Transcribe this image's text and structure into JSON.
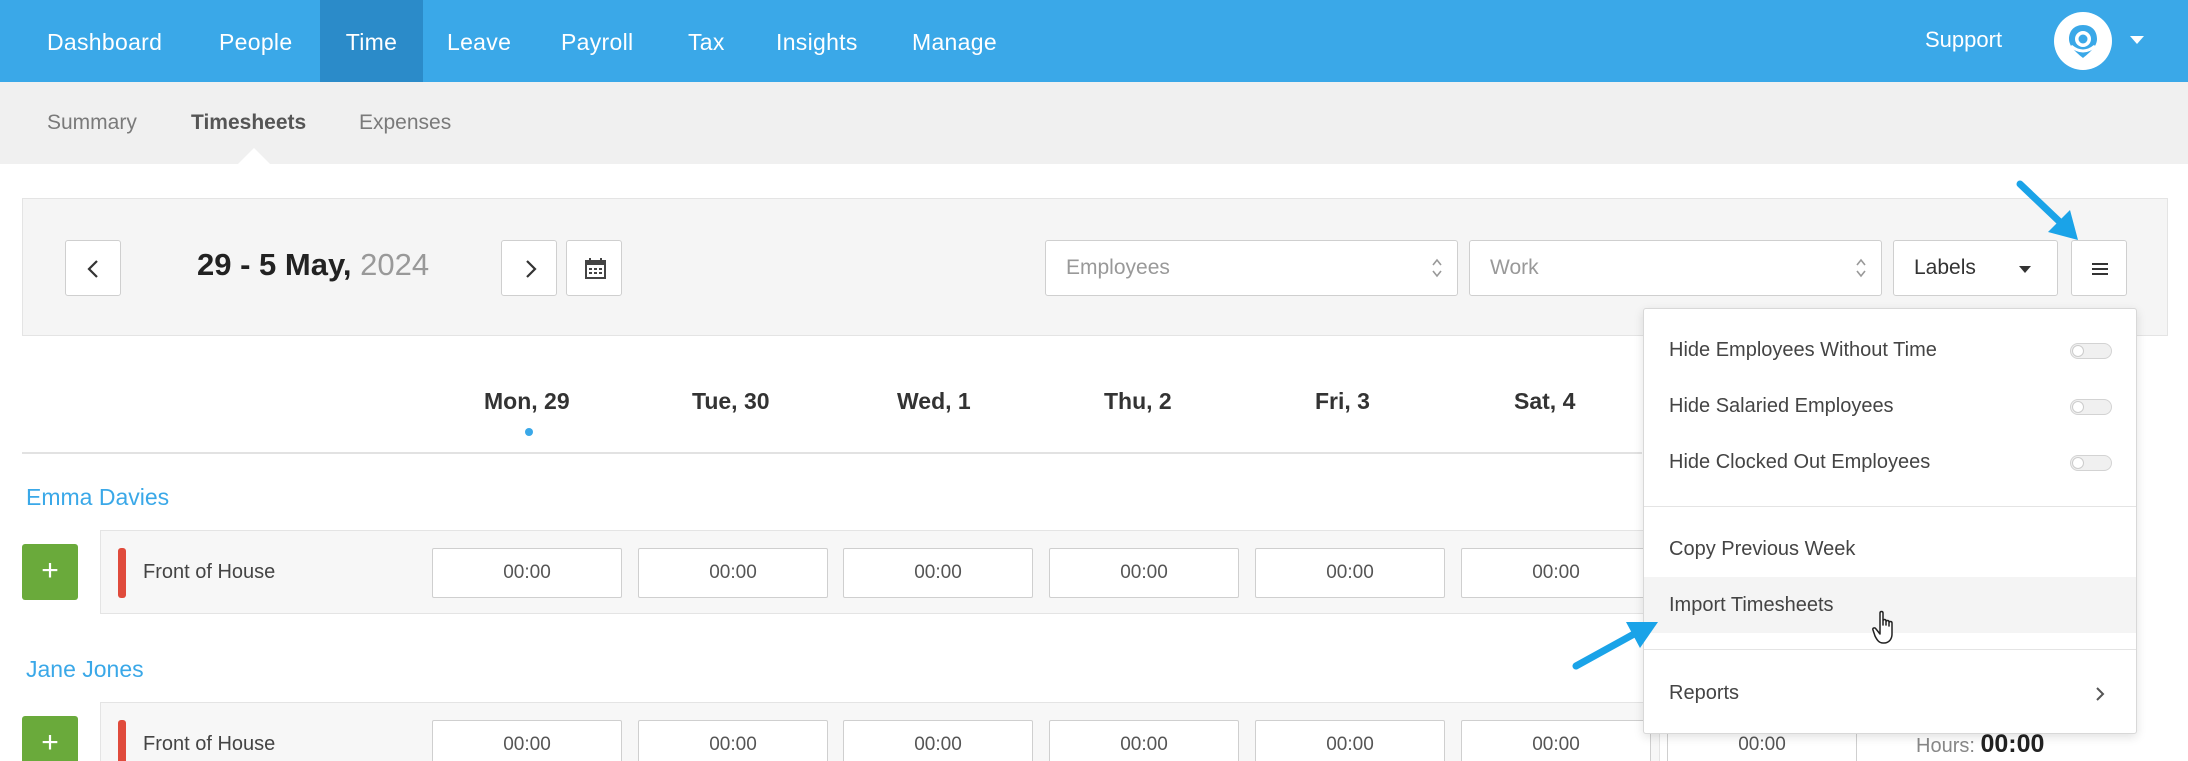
{
  "topnav": {
    "items": [
      {
        "label": "Dashboard",
        "active": false
      },
      {
        "label": "People",
        "active": false
      },
      {
        "label": "Time",
        "active": true
      },
      {
        "label": "Leave",
        "active": false
      },
      {
        "label": "Payroll",
        "active": false
      },
      {
        "label": "Tax",
        "active": false
      },
      {
        "label": "Insights",
        "active": false
      },
      {
        "label": "Manage",
        "active": false
      }
    ],
    "support_label": "Support",
    "accent_color": "#3aa8e8"
  },
  "subnav": {
    "items": [
      {
        "label": "Summary",
        "active": false
      },
      {
        "label": "Timesheets",
        "active": true
      },
      {
        "label": "Expenses",
        "active": false
      }
    ]
  },
  "toolbar": {
    "date_range": "29 - 5 May,",
    "year": "2024",
    "employees_placeholder": "Employees",
    "work_placeholder": "Work",
    "labels_label": "Labels"
  },
  "days": [
    "Mon, 29",
    "Tue, 30",
    "Wed, 1",
    "Thu, 2",
    "Fri, 3",
    "Sat, 4"
  ],
  "employees": [
    {
      "name": "Emma Davies",
      "role": "Front of House",
      "times": [
        "00:00",
        "00:00",
        "00:00",
        "00:00",
        "00:00",
        "00:00"
      ]
    },
    {
      "name": "Jane Jones",
      "role": "Front of House",
      "times": [
        "00:00",
        "00:00",
        "00:00",
        "00:00",
        "00:00",
        "00:00",
        "00:00"
      ],
      "hours_label": "Hours:",
      "hours_value": "00:00"
    }
  ],
  "menu": {
    "toggles": [
      {
        "label": "Hide Employees Without Time",
        "on": false
      },
      {
        "label": "Hide Salaried Employees",
        "on": false
      },
      {
        "label": "Hide Clocked Out Employees",
        "on": false
      }
    ],
    "copy_previous_week": "Copy Previous Week",
    "import_timesheets": "Import Timesheets",
    "reports": "Reports"
  },
  "colors": {
    "add_button": "#6aaa3b",
    "row_marker": "#e04b3c",
    "annotation_arrow": "#1aa3e8"
  }
}
